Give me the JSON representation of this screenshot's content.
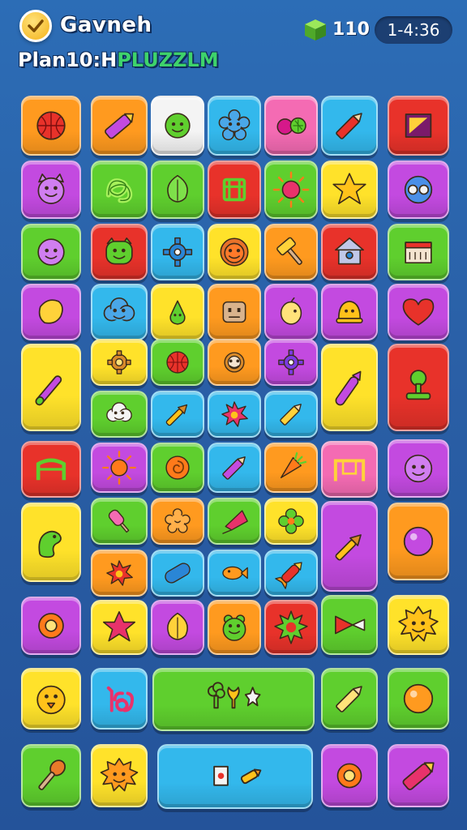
{
  "hud": {
    "title": "Gavneh",
    "subtitle_main": "Plan10:H",
    "subtitle_accent": "PLUZZLM",
    "gem_count": "110",
    "timer": "1-4:36",
    "gem_color": "#5fc13a"
  },
  "palette": {
    "orange": "#ff9a1f",
    "yellow": "#ffe22a",
    "green": "#5fcf2e",
    "cyan": "#33b8ec",
    "purple": "#c34ae0",
    "pink": "#f46bb3",
    "red": "#e8322a",
    "white": "#f4f4f4"
  },
  "tiles": [
    {
      "name": "tile-ball",
      "color": "orange",
      "icon": "ball-icon",
      "ic": "#e8322a"
    },
    {
      "name": "tile-crayon",
      "color": "orange",
      "icon": "crayon-icon",
      "ic": "#c34ae0"
    },
    {
      "name": "tile-smile",
      "color": "white",
      "icon": "smile-face-icon",
      "ic": "#5fcf2e"
    },
    {
      "name": "tile-flower",
      "color": "cyan",
      "icon": "flower-icon",
      "ic": "#4aa7e8"
    },
    {
      "name": "tile-berries",
      "color": "pink",
      "icon": "berries-icon",
      "ic": "#d6188a"
    },
    {
      "name": "tile-pencil",
      "color": "cyan",
      "icon": "pencil-icon",
      "ic": "#e8322a"
    },
    {
      "name": "tile-flag",
      "color": "red",
      "icon": "flag-icon",
      "ic": "#ffd23a"
    },
    {
      "name": "tile-cat",
      "color": "purple",
      "icon": "cat-face-icon",
      "ic": "#d07ef0"
    },
    {
      "name": "tile-knot",
      "color": "green",
      "icon": "knot-icon",
      "ic": "#a6f05a"
    },
    {
      "name": "tile-leaf",
      "color": "green",
      "icon": "leaf-icon",
      "ic": "#7ee04a"
    },
    {
      "name": "tile-gate",
      "color": "red",
      "icon": "gate-icon",
      "ic": "#5fcf2e"
    },
    {
      "name": "tile-sun-red",
      "color": "green",
      "icon": "sun-icon",
      "ic": "#e8326b"
    },
    {
      "name": "tile-star",
      "color": "yellow",
      "icon": "star-icon",
      "ic": "#ffc21a"
    },
    {
      "name": "tile-goggles",
      "color": "purple",
      "icon": "goggles-icon",
      "ic": "#4a8fe8"
    },
    {
      "name": "tile-purple-face",
      "color": "green",
      "icon": "face-icon",
      "ic": "#d07ef0"
    },
    {
      "name": "tile-monster",
      "color": "red",
      "icon": "monster-icon",
      "ic": "#5fcf2e"
    },
    {
      "name": "tile-gear",
      "color": "cyan",
      "icon": "gear-icon",
      "ic": "#2a86d6"
    },
    {
      "name": "tile-lion",
      "color": "yellow",
      "icon": "lion-face-icon",
      "ic": "#ff7a2a"
    },
    {
      "name": "tile-hammer",
      "color": "orange",
      "icon": "hammer-icon",
      "ic": "#ffd23a"
    },
    {
      "name": "tile-house",
      "color": "red",
      "icon": "house-icon",
      "ic": "#c0c8e8"
    },
    {
      "name": "tile-shop",
      "color": "green",
      "icon": "shop-icon",
      "ic": "#f4e4d0"
    },
    {
      "name": "tile-blob",
      "color": "purple",
      "icon": "blob-icon",
      "ic": "#ffd23a"
    },
    {
      "name": "tile-cloud",
      "color": "cyan",
      "icon": "cloud-face-icon",
      "ic": "#4aa7e8"
    },
    {
      "name": "tile-pear",
      "color": "yellow",
      "icon": "pear-icon",
      "ic": "#5fcf2e"
    },
    {
      "name": "tile-robot",
      "color": "orange",
      "icon": "robot-face-icon",
      "ic": "#d9b38c"
    },
    {
      "name": "tile-lemon",
      "color": "purple",
      "icon": "lemon-icon",
      "ic": "#ffe27a"
    },
    {
      "name": "tile-bell",
      "color": "purple",
      "icon": "bell-icon",
      "ic": "#ffc21a"
    },
    {
      "name": "tile-heart",
      "color": "purple",
      "icon": "heart-icon",
      "ic": "#e8322a"
    },
    {
      "name": "tile-wand-tall",
      "color": "yellow",
      "icon": "wand-icon",
      "ic": "#c34ae0"
    },
    {
      "name": "tile-cog",
      "color": "yellow",
      "icon": "cog-icon",
      "ic": "#d88a2a"
    },
    {
      "name": "tile-red-ball",
      "color": "green",
      "icon": "ball-icon",
      "ic": "#e8322a"
    },
    {
      "name": "tile-donut",
      "color": "orange",
      "icon": "donut-icon",
      "ic": "#f4e4d0"
    },
    {
      "name": "tile-purple-gear",
      "color": "purple",
      "icon": "gear-icon",
      "ic": "#7a3ae0"
    },
    {
      "name": "tile-marker-tall",
      "color": "yellow",
      "icon": "marker-icon",
      "ic": "#c34ae0"
    },
    {
      "name": "tile-joystick",
      "color": "red",
      "icon": "joystick-icon",
      "ic": "#5fcf2e"
    },
    {
      "name": "tile-cloud-white",
      "color": "green",
      "icon": "cloud-face-icon",
      "ic": "#f4f4f4"
    },
    {
      "name": "tile-brush",
      "color": "cyan",
      "icon": "brush-icon",
      "ic": "#ffc21a"
    },
    {
      "name": "tile-splat",
      "color": "cyan",
      "icon": "splat-icon",
      "ic": "#e8326b"
    },
    {
      "name": "tile-pencil-yellow",
      "color": "cyan",
      "icon": "pencil-icon",
      "ic": "#ffd23a"
    },
    {
      "name": "tile-arch",
      "color": "red",
      "icon": "arch-icon",
      "ic": "#5fcf2e"
    },
    {
      "name": "tile-sunburst",
      "color": "purple",
      "icon": "sun-icon",
      "ic": "#ff7a1a"
    },
    {
      "name": "tile-swirl",
      "color": "green",
      "icon": "swirl-icon",
      "ic": "#ff7a1a"
    },
    {
      "name": "tile-pen",
      "color": "cyan",
      "icon": "pencil-icon",
      "ic": "#c34ae0"
    },
    {
      "name": "tile-carrot",
      "color": "orange",
      "icon": "carrot-icon",
      "ic": "#5fcf2e"
    },
    {
      "name": "tile-swing",
      "color": "pink",
      "icon": "swing-icon",
      "ic": "#ffd23a"
    },
    {
      "name": "tile-bubble",
      "color": "purple",
      "icon": "smile-face-icon",
      "ic": "#d07ef0"
    },
    {
      "name": "tile-dino",
      "color": "yellow",
      "icon": "dino-icon",
      "ic": "#5fcf2e"
    },
    {
      "name": "tile-popsicle",
      "color": "green",
      "icon": "popsicle-icon",
      "ic": "#f46bb3"
    },
    {
      "name": "tile-cookie",
      "color": "orange",
      "icon": "cookie-icon",
      "ic": "#ffb04a"
    },
    {
      "name": "tile-kite",
      "color": "green",
      "icon": "kite-icon",
      "ic": "#e8326b"
    },
    {
      "name": "tile-clover",
      "color": "yellow",
      "icon": "clover-icon",
      "ic": "#5fcf2e"
    },
    {
      "name": "tile-brush-tall",
      "color": "purple",
      "icon": "brush-icon",
      "ic": "#ffc21a"
    },
    {
      "name": "tile-orb",
      "color": "orange",
      "icon": "orb-icon",
      "ic": "#c34ae0"
    },
    {
      "name": "tile-splash",
      "color": "orange",
      "icon": "splat-icon",
      "ic": "#e8322a"
    },
    {
      "name": "tile-pill",
      "color": "cyan",
      "icon": "pill-icon",
      "ic": "#2a86d6"
    },
    {
      "name": "tile-fish",
      "color": "cyan",
      "icon": "fish-icon",
      "ic": "#ff9a1f"
    },
    {
      "name": "tile-rocket",
      "color": "cyan",
      "icon": "rocket-icon",
      "ic": "#e8322a"
    },
    {
      "name": "tile-ring",
      "color": "purple",
      "icon": "ring-icon",
      "ic": "#ff7a1a"
    },
    {
      "name": "tile-starburst",
      "color": "yellow",
      "icon": "star-icon",
      "ic": "#e8326b"
    },
    {
      "name": "tile-feather",
      "color": "purple",
      "icon": "leaf-icon",
      "ic": "#ffd23a"
    },
    {
      "name": "tile-frog",
      "color": "orange",
      "icon": "frog-face-icon",
      "ic": "#5fcf2e"
    },
    {
      "name": "tile-spiky",
      "color": "red",
      "icon": "spiky-icon",
      "ic": "#5fcf2e"
    },
    {
      "name": "tile-shuttlecock",
      "color": "green",
      "icon": "shuttlecock-icon",
      "ic": "#e8322a"
    },
    {
      "name": "tile-sunface",
      "color": "yellow",
      "icon": "sun-face-icon",
      "ic": "#ffc21a"
    },
    {
      "name": "tile-chick",
      "color": "yellow",
      "icon": "chick-face-icon",
      "ic": "#ffc21a"
    },
    {
      "name": "tile-sixteen",
      "color": "cyan",
      "icon": "number-sign-icon",
      "ic": "#e8326b"
    },
    {
      "name": "tile-trio",
      "color": "green",
      "icon": "trio-icon",
      "ic": "#5fcf2e"
    },
    {
      "name": "tile-needle",
      "color": "green",
      "icon": "pencil-icon",
      "ic": "#ffe27a"
    },
    {
      "name": "tile-apple",
      "color": "green",
      "icon": "orb-icon",
      "ic": "#ff9a1f"
    },
    {
      "name": "tile-paddle",
      "color": "green",
      "icon": "paddle-icon",
      "ic": "#e87a2a"
    },
    {
      "name": "tile-lionface",
      "color": "yellow",
      "icon": "sun-face-icon",
      "ic": "#ff9a1f"
    },
    {
      "name": "tile-duo",
      "color": "cyan",
      "icon": "duo-icon",
      "ic": "#ffc21a"
    },
    {
      "name": "tile-donut2",
      "color": "purple",
      "icon": "ring-icon",
      "ic": "#ff7a1a"
    },
    {
      "name": "tile-lipstick",
      "color": "purple",
      "icon": "crayon-icon",
      "ic": "#e8326b"
    }
  ]
}
